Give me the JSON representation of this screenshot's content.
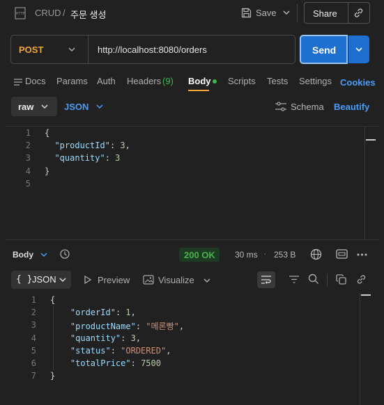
{
  "header": {
    "breadcrumb_parent": "CRUD",
    "separator": "/",
    "title": "주문 생성",
    "save_label": "Save",
    "share_label": "Share",
    "method_icon_text": "HTTP"
  },
  "request": {
    "method": "POST",
    "url": "http://localhost:8080/orders",
    "send_label": "Send"
  },
  "tabs": {
    "docs": "Docs",
    "params": "Params",
    "auth": "Auth",
    "headers": "Headers",
    "headers_count": "(9)",
    "body": "Body",
    "scripts": "Scripts",
    "tests": "Tests",
    "settings": "Settings",
    "cookies": "Cookies"
  },
  "body_options": {
    "mode": "raw",
    "format": "JSON",
    "schema": "Schema",
    "beautify": "Beautify"
  },
  "request_body": {
    "line_numbers": [
      "1",
      "2",
      "3",
      "4",
      "5"
    ],
    "lines": [
      [
        {
          "t": "{",
          "c": "p"
        }
      ],
      [
        {
          "t": "  ",
          "c": "p"
        },
        {
          "t": "\"productId\"",
          "c": "k"
        },
        {
          "t": ": ",
          "c": "p"
        },
        {
          "t": "3",
          "c": "n"
        },
        {
          "t": ",",
          "c": "p"
        }
      ],
      [
        {
          "t": "  ",
          "c": "p"
        },
        {
          "t": "\"quantity\"",
          "c": "k"
        },
        {
          "t": ": ",
          "c": "p"
        },
        {
          "t": "3",
          "c": "n"
        }
      ],
      [
        {
          "t": "}",
          "c": "p"
        }
      ],
      []
    ]
  },
  "response": {
    "section_label": "Body",
    "status": "200 OK",
    "time": "30 ms",
    "size": "253 B",
    "view_format": "JSON",
    "format_prefix": "{ }",
    "preview": "Preview",
    "visualize": "Visualize",
    "status_color": "#4caf50",
    "line_numbers": [
      "1",
      "2",
      "3",
      "4",
      "5",
      "6",
      "7"
    ],
    "lines": [
      [
        {
          "t": "{",
          "c": "p"
        }
      ],
      [
        {
          "t": "    ",
          "c": "p"
        },
        {
          "t": "\"orderId\"",
          "c": "k"
        },
        {
          "t": ": ",
          "c": "p"
        },
        {
          "t": "1",
          "c": "n"
        },
        {
          "t": ",",
          "c": "p"
        }
      ],
      [
        {
          "t": "    ",
          "c": "p"
        },
        {
          "t": "\"productName\"",
          "c": "k"
        },
        {
          "t": ": ",
          "c": "p"
        },
        {
          "t": "\"메론빵\"",
          "c": "s"
        },
        {
          "t": ",",
          "c": "p"
        }
      ],
      [
        {
          "t": "    ",
          "c": "p"
        },
        {
          "t": "\"quantity\"",
          "c": "k"
        },
        {
          "t": ": ",
          "c": "p"
        },
        {
          "t": "3",
          "c": "n"
        },
        {
          "t": ",",
          "c": "p"
        }
      ],
      [
        {
          "t": "    ",
          "c": "p"
        },
        {
          "t": "\"status\"",
          "c": "k"
        },
        {
          "t": ": ",
          "c": "p"
        },
        {
          "t": "\"ORDERED\"",
          "c": "s"
        },
        {
          "t": ",",
          "c": "p"
        }
      ],
      [
        {
          "t": "    ",
          "c": "p"
        },
        {
          "t": "\"totalPrice\"",
          "c": "k"
        },
        {
          "t": ": ",
          "c": "p"
        },
        {
          "t": "7500",
          "c": "n"
        }
      ],
      [
        {
          "t": "}",
          "c": "p"
        }
      ]
    ]
  },
  "colors": {
    "accent_blue": "#1f6fd1",
    "link_blue": "#4a9cf5",
    "method_orange": "#f0a63c",
    "dot_green": "#3fb950"
  }
}
